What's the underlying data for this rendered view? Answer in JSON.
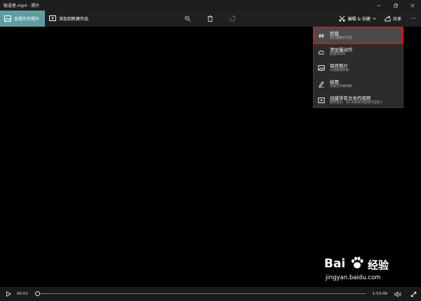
{
  "window": {
    "title": "极道者.mp4 - 照片"
  },
  "toolbar": {
    "view_all_label": "查看所有照片",
    "add_new_label": "添加到新建作品",
    "edit_create_label": "编辑 & 创建",
    "share_label": "共享",
    "more_label": "···"
  },
  "menu": {
    "items": [
      {
        "title": "剪裁",
        "subtitle": "更先最精彩时刻",
        "icon": "trim-icon"
      },
      {
        "title": "添加慢动作",
        "subtitle": "超慢到实时",
        "icon": "slow-motion-icon"
      },
      {
        "title": "保存照片",
        "subtitle": "从视频保存帧",
        "icon": "save-photo-icon"
      },
      {
        "title": "绘图",
        "subtitle": "添加艺术素材库",
        "icon": "draw-icon"
      },
      {
        "title": "创建带有文本的视频",
        "subtitle": "使用音乐、3D 效果等内容进行自定义",
        "icon": "video-text-icon"
      }
    ]
  },
  "player": {
    "current_time": "00:01",
    "total_time": "1:53:49",
    "progress": 0.0
  },
  "watermark": {
    "brand": "Bai",
    "brand_suffix": "经验",
    "url": "jingyan.baidu.com"
  },
  "colors": {
    "accent": "#5f9ea0",
    "highlight": "#e01010"
  }
}
